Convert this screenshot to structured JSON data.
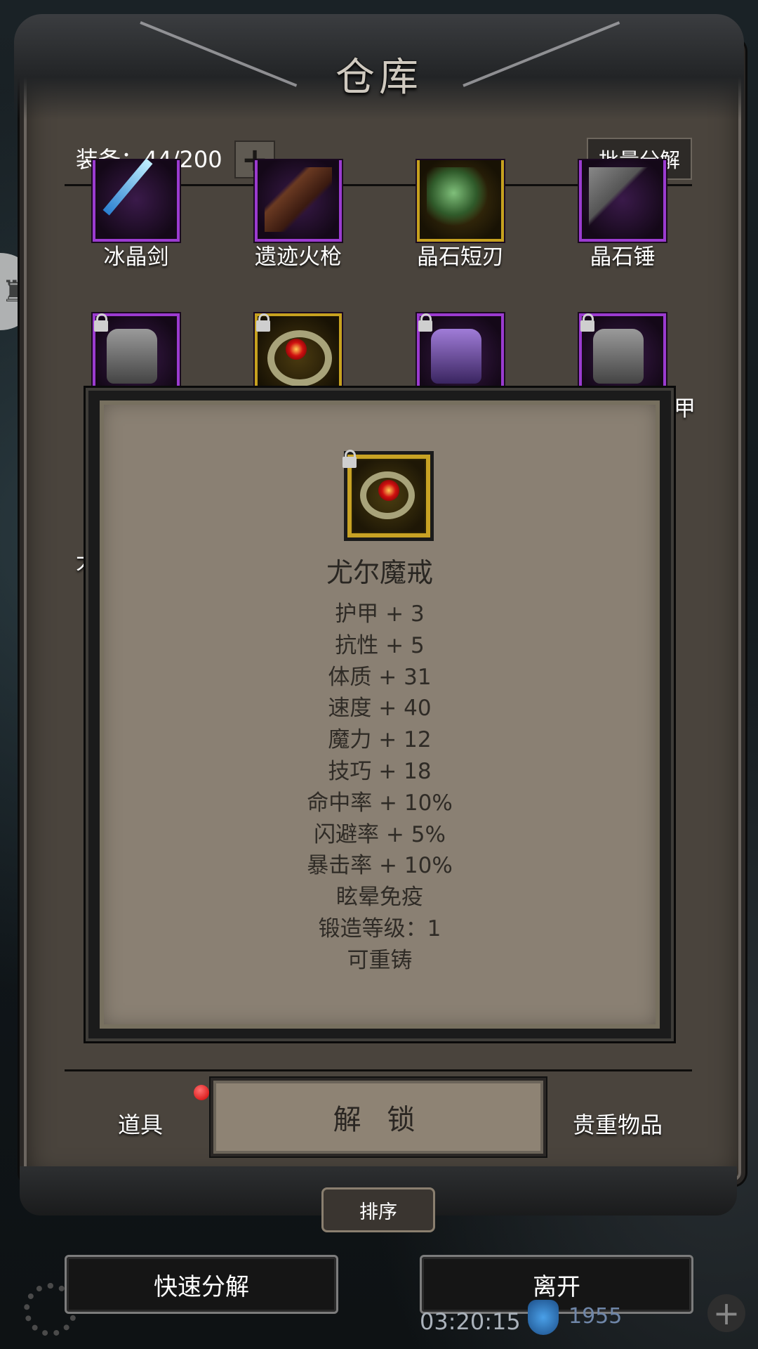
{
  "window": {
    "title": "仓库"
  },
  "header": {
    "equipment_count": "装备：44/200",
    "batch_label": "批量分解"
  },
  "items_row1": [
    {
      "name": "冰晶剑"
    },
    {
      "name": "遗迹火枪"
    },
    {
      "name": "晶石短刃"
    },
    {
      "name": "晶石锤"
    }
  ],
  "edge_text": {
    "right_row2": "甲",
    "left_mid": "大"
  },
  "tooltip": {
    "item_name": "尤尔魔戒",
    "stats": [
      "护甲 + 3",
      "抗性 + 5",
      "体质 + 31",
      "速度 + 40",
      "魔力 + 12",
      "技巧 + 18",
      "命中率 + 10%",
      "闪避率 + 5%",
      "暴击率 + 10%",
      "眩晕免疫",
      "锻造等级：1",
      "可重铸"
    ]
  },
  "tabs": {
    "left": "道具",
    "right": "贵重物品",
    "unlock": "解 锁"
  },
  "sort_label": "排序",
  "bottom": {
    "quick_dismantle": "快速分解",
    "leave": "离开",
    "timer": "03:20:15",
    "number": "1955"
  },
  "icons": [
    "plus-icon",
    "lock-icon",
    "gear-icon",
    "shield-icon",
    "hud-plus-icon"
  ]
}
